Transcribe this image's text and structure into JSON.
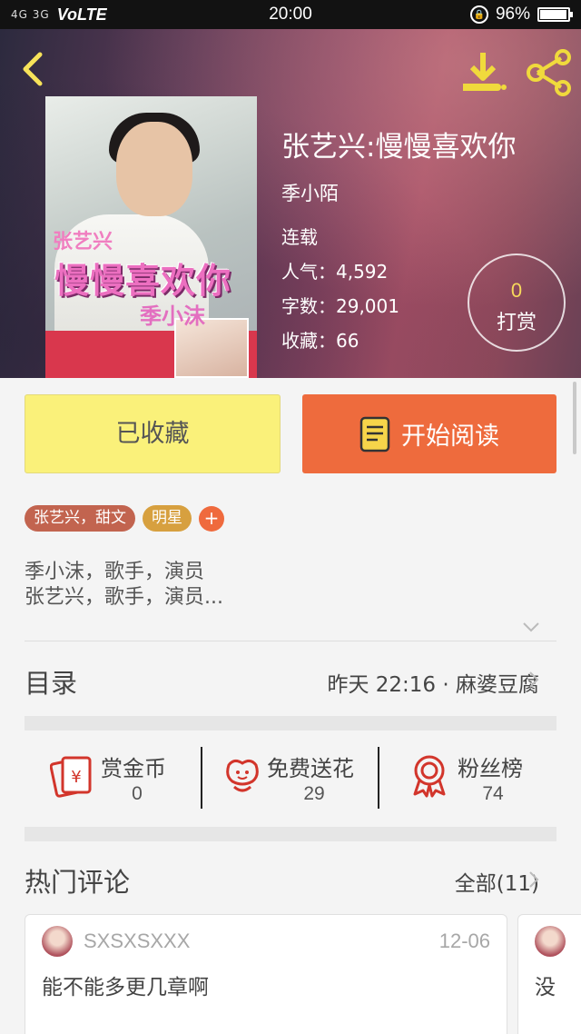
{
  "status_bar": {
    "signal": "4G 3G",
    "network": "VoLTE",
    "time": "20:00",
    "battery_percent": "96%",
    "battery_level": 0.96
  },
  "header": {
    "back_icon": "chevron-left-icon",
    "download_icon": "download-icon",
    "share_icon": "share-icon",
    "cover": {
      "line1": "张艺兴",
      "line2": "慢慢喜欢你",
      "line3": "季小沫"
    },
    "title": "张艺兴:慢慢喜欢你",
    "author": "季小陌",
    "status": "连载",
    "popularity": "人气：4,592",
    "word_count": "字数：29,001",
    "favorites": "收藏：66",
    "reward": {
      "count": "0",
      "label": "打赏"
    },
    "accent_color": "#f7d95b"
  },
  "actions": {
    "favorited_label": "已收藏",
    "start_reading_label": "开始阅读"
  },
  "tags": [
    "张艺兴，甜文",
    "明星"
  ],
  "tag_add": "+",
  "description": {
    "line1": "季小沫，歌手，演员",
    "line2": "张艺兴，歌手，演员..."
  },
  "toc": {
    "label": "目录",
    "latest": "昨天 22:16 · 麻婆豆腐"
  },
  "stats": [
    {
      "label": "赏金币",
      "value": "0",
      "icon": "red-envelope-icon"
    },
    {
      "label": "免费送花",
      "value": "29",
      "icon": "flower-icon"
    },
    {
      "label": "粉丝榜",
      "value": "74",
      "icon": "medal-icon"
    }
  ],
  "comments": {
    "label": "热门评论",
    "all_label": "全部(11)",
    "items": [
      {
        "user": "SXSXSXXX",
        "date": "12-06",
        "text": "能不能多更几章啊"
      },
      {
        "user": "",
        "date": "",
        "text": "没"
      }
    ]
  },
  "colors": {
    "primary_orange": "#ee6b3d",
    "favorite_yellow": "#faf17a",
    "icon_red": "#d2352b"
  }
}
